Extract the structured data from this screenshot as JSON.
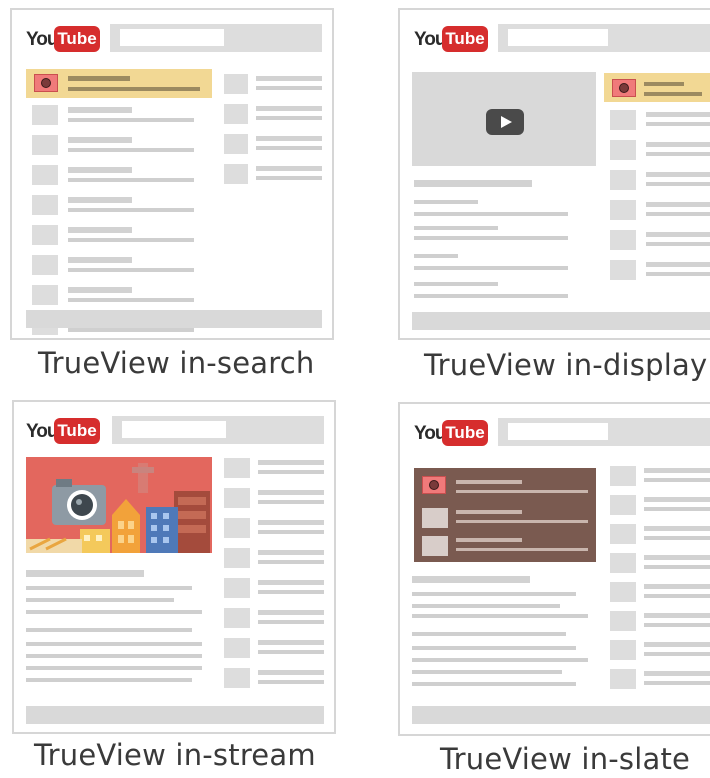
{
  "panels": [
    {
      "logo_you": "You",
      "logo_tube": "Tube",
      "caption": "TrueView in-search"
    },
    {
      "logo_you": "You",
      "logo_tube": "Tube",
      "caption": "TrueView in-display"
    },
    {
      "logo_you": "You",
      "logo_tube": "Tube",
      "caption": "TrueView in-stream"
    },
    {
      "logo_you": "You",
      "logo_tube": "Tube",
      "caption": "TrueView in-slate"
    }
  ],
  "colors": {
    "highlight": "#f2d894",
    "logo_red": "#d62d2d",
    "placeholder": "#dddddd",
    "slate_brown": "#7a5a50",
    "stream_red": "#e46a5e"
  },
  "icons": [
    "youtube-logo",
    "camera-icon",
    "play-icon"
  ]
}
